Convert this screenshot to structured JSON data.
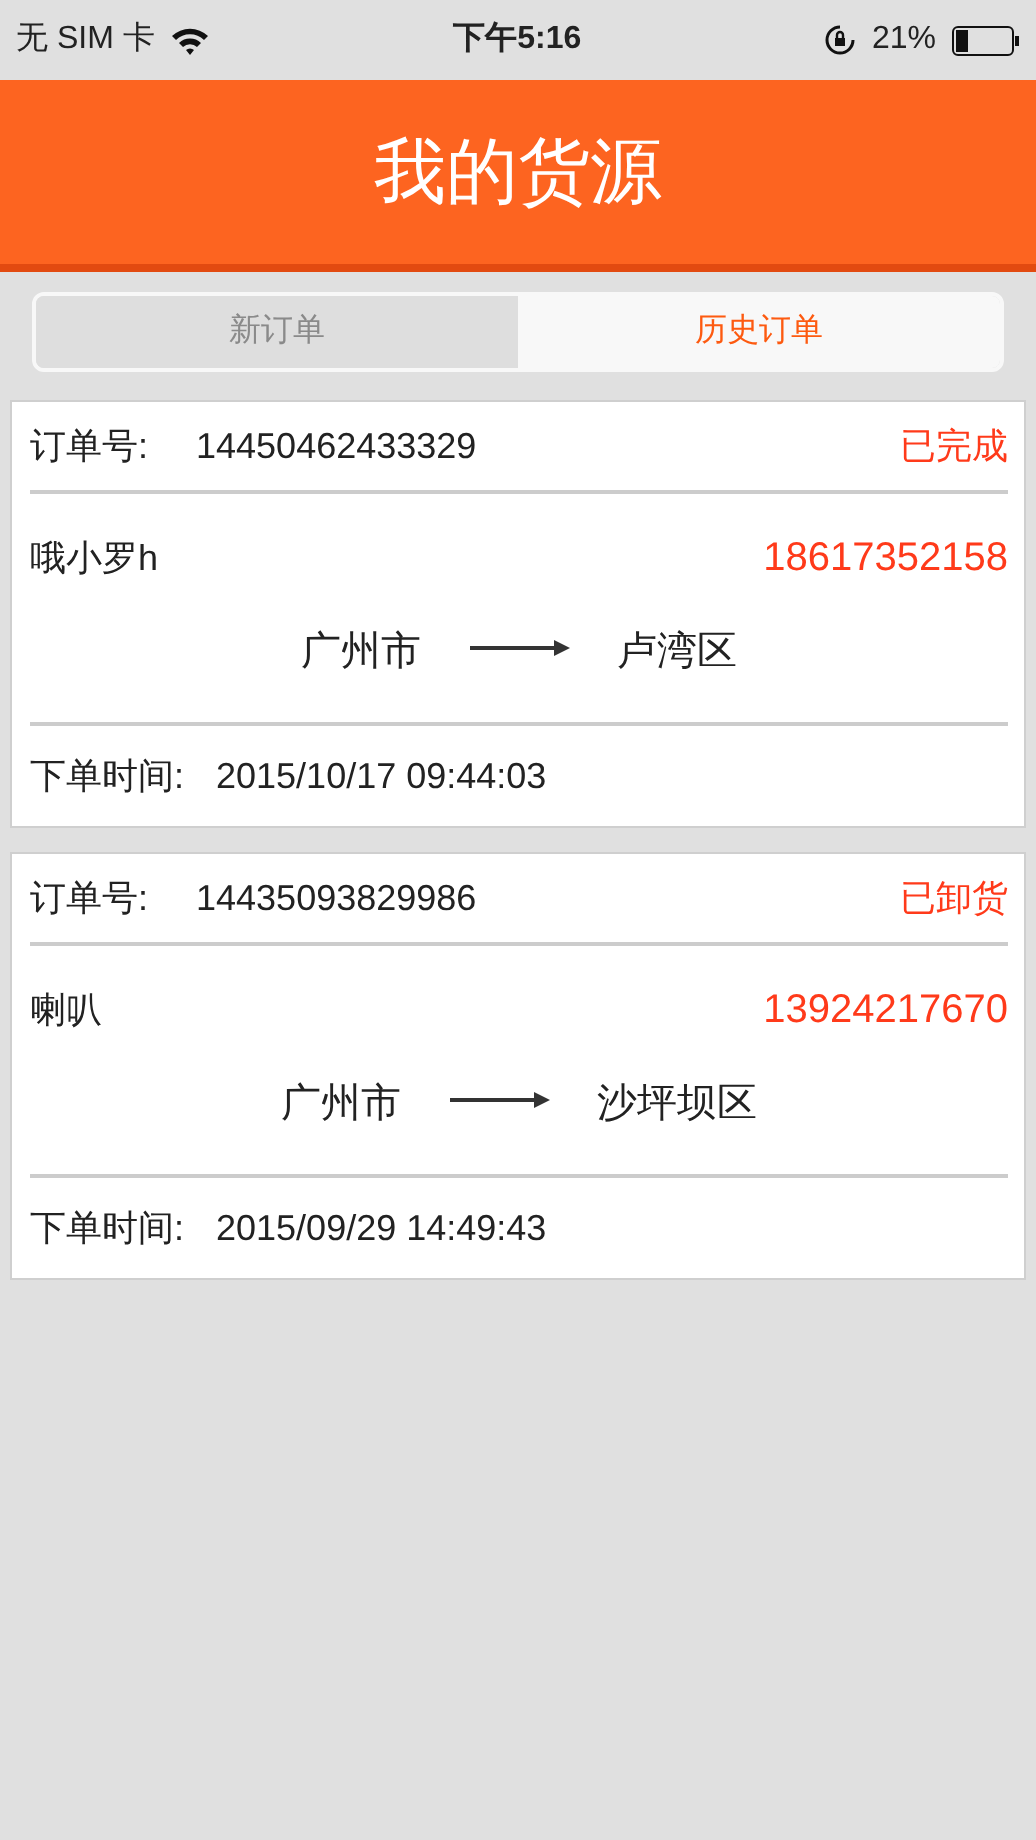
{
  "status_bar": {
    "carrier": "无 SIM 卡",
    "time": "下午5:16",
    "battery": "21%"
  },
  "header": {
    "title": "我的货源"
  },
  "tabs": [
    {
      "label": "新订单",
      "selected": false
    },
    {
      "label": "历史订单",
      "selected": true
    }
  ],
  "orders": [
    {
      "order_label": "订单号:",
      "order_no": "14450462433329",
      "status": "已完成",
      "name": "哦小罗h",
      "phone": "18617352158",
      "from": "广州市",
      "to": "卢湾区",
      "time_label": "下单时间:",
      "time": "2015/10/17 09:44:03"
    },
    {
      "order_label": "订单号:",
      "order_no": "14435093829986",
      "status": "已卸货",
      "name": "喇叭",
      "phone": "13924217670",
      "from": "广州市",
      "to": "沙坪坝区",
      "time_label": "下单时间:",
      "time": "2015/09/29 14:49:43"
    }
  ]
}
